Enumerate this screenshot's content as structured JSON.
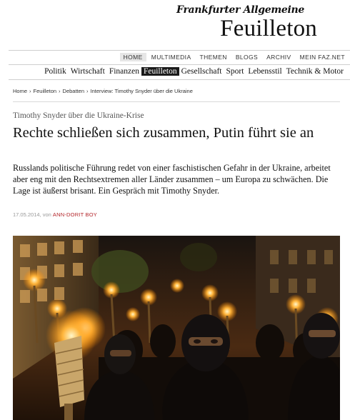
{
  "masthead": {
    "newspaper_name": "Frankfurter Allgemeine",
    "section_title": "Feuilleton"
  },
  "top_nav": {
    "items": [
      {
        "label": "HOME",
        "active": true
      },
      {
        "label": "MULTIMEDIA",
        "active": false
      },
      {
        "label": "THEMEN",
        "active": false
      },
      {
        "label": "BLOGS",
        "active": false
      },
      {
        "label": "ARCHIV",
        "active": false
      },
      {
        "label": "MEIN FAZ.NET",
        "active": false
      }
    ]
  },
  "section_nav": {
    "items": [
      {
        "label": "Politik",
        "active": false
      },
      {
        "label": "Wirtschaft",
        "active": false
      },
      {
        "label": "Finanzen",
        "active": false
      },
      {
        "label": "Feuilleton",
        "active": true
      },
      {
        "label": "Gesellschaft",
        "active": false
      },
      {
        "label": "Sport",
        "active": false
      },
      {
        "label": "Lebensstil",
        "active": false
      },
      {
        "label": "Technik & Motor",
        "active": false
      }
    ]
  },
  "breadcrumb": {
    "items": [
      "Home",
      "Feuilleton",
      "Debatten",
      "Interview: Timothy Snyder über die Ukraine"
    ],
    "separator": "›"
  },
  "article": {
    "kicker": "Timothy Snyder über die Ukraine-Krise",
    "headline": "Rechte schließen sich zusammen, Putin führt sie an",
    "teaser": "Russlands politische Führung redet von einer faschistischen Gefahr in der Ukraine, arbeitet aber eng mit den Rechtsextremen aller Länder zusammen – um Europa zu schwächen. Die Lage ist äußerst brisant. Ein Gespräch mit Timothy Snyder.",
    "date": "17.05.2014",
    "byline_prefix": "von",
    "author": "ANN-DORIT BOY"
  },
  "photo": {
    "alt": "torchlight march with masked men"
  },
  "colors": {
    "accent_red": "#b3252a",
    "active_section_bg": "#1a1a1a",
    "active_top_bg": "#e6e6e6"
  }
}
